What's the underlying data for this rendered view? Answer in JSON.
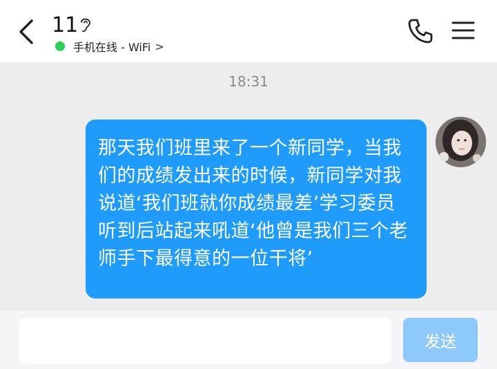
{
  "header": {
    "contact_name": "11",
    "status_text": "手机在线 - WiFi",
    "status_chevron": ">",
    "status_color": "#2ed158",
    "back_icon": "chevron-left-icon",
    "ear_icon": "ear-icon",
    "phone_icon": "phone-icon",
    "menu_icon": "menu-icon"
  },
  "chat": {
    "timestamp": "18:31",
    "messages": [
      {
        "side": "right",
        "text": "那天我们班里来了一个新同学，当我们的成绩发出来的时候，新同学对我说道‘我们班就你成绩最差’学习委员听到后站起来吼道‘他曾是我们三个老师手下最得意的一位干将’",
        "bubble_color": "#1e9bfb"
      }
    ]
  },
  "composer": {
    "input_value": "",
    "send_label": "发送",
    "send_color": "#8ec9fb"
  }
}
